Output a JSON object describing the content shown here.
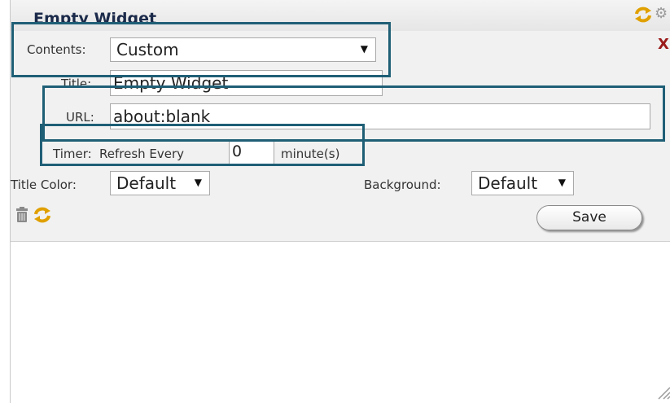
{
  "widget": {
    "title": "Empty Widget",
    "close_label": "X"
  },
  "form": {
    "contents": {
      "label": "Contents:",
      "value": "Custom"
    },
    "title_field": {
      "label": "Title:",
      "value": "Empty Widget"
    },
    "url": {
      "label": "URL:",
      "value": "about:blank"
    },
    "timer": {
      "label": "Timer:",
      "prefix": "Refresh Every",
      "value": "0",
      "unit": "minute(s)"
    },
    "title_color": {
      "label": "Title Color:",
      "value": "Default"
    },
    "background": {
      "label": "Background:",
      "value": "Default"
    },
    "save_label": "Save"
  },
  "icons": {
    "titlebar": [
      "refresh-icon",
      "gear-icon"
    ],
    "settings": [
      "trash-icon",
      "refresh-icon"
    ]
  },
  "colors": {
    "highlight_box": "#1f5f76",
    "refresh_icon": "#e0a000",
    "close": "#9b1b1b",
    "title_text": "#1b2a4a"
  }
}
